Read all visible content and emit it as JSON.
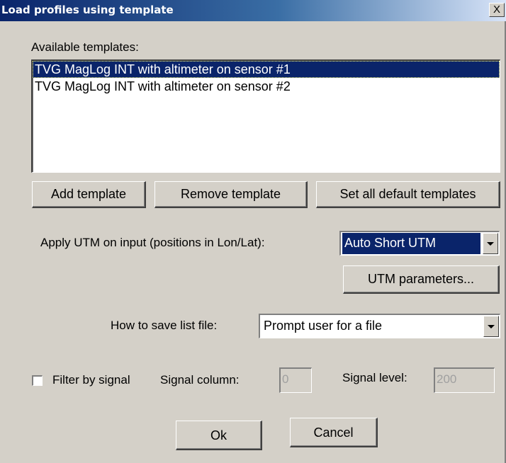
{
  "window": {
    "title": "Load profiles using template",
    "close_glyph": "X"
  },
  "templates": {
    "label": "Available templates:",
    "items": [
      "TVG MagLog INT with altimeter on sensor #1",
      "TVG MagLog INT with altimeter on sensor #2"
    ],
    "selected_index": 0
  },
  "buttons": {
    "add": "Add template",
    "remove": "Remove template",
    "set_defaults": "Set all default templates",
    "utm_params": "UTM parameters...",
    "ok": "Ok",
    "cancel": "Cancel"
  },
  "utm": {
    "label": "Apply UTM on input (positions in Lon/Lat):",
    "value": "Auto Short UTM"
  },
  "save": {
    "label": "How to save list file:",
    "value": "Prompt user for a file"
  },
  "filter": {
    "checkbox_label": "Filter by signal",
    "checked": false,
    "column_label": "Signal column:",
    "column_value": "0",
    "level_label": "Signal level:",
    "level_value": "200"
  },
  "colors": {
    "selection": "#0a246a",
    "dialog_bg": "#d4d0c8"
  }
}
